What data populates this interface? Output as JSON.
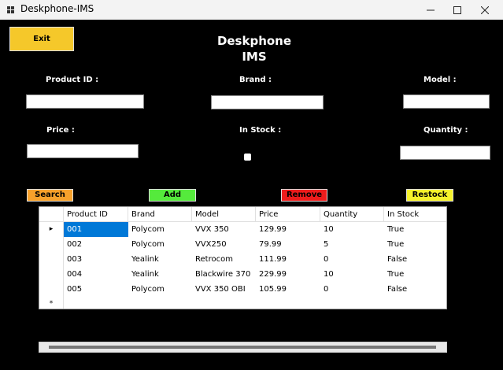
{
  "window": {
    "title": "Deskphone-IMS",
    "minimize_icon": "minimize-icon",
    "maximize_icon": "maximize-icon",
    "close_icon": "close-icon"
  },
  "header": {
    "title_line1": "Deskphone",
    "title_line2": "IMS"
  },
  "buttons": {
    "exit": {
      "label": "Exit",
      "color": "#f5c82a"
    },
    "search": {
      "label": "Search",
      "color": "#f7a12b"
    },
    "add": {
      "label": "Add",
      "color": "#55ea3c"
    },
    "remove": {
      "label": "Remove",
      "color": "#ee1c1c"
    },
    "restock": {
      "label": "Restock",
      "color": "#f5f22b"
    }
  },
  "form": {
    "product_id_label": "Product ID :",
    "brand_label": "Brand :",
    "model_label": "Model :",
    "price_label": "Price :",
    "in_stock_label": "In Stock :",
    "quantity_label": "Quantity :",
    "product_id_value": "",
    "brand_value": "",
    "model_value": "",
    "price_value": "",
    "quantity_value": "",
    "in_stock_checked": false
  },
  "table": {
    "columns": [
      "Product ID",
      "Brand",
      "Model",
      "Price",
      "Quantity",
      "In Stock"
    ],
    "rows": [
      [
        "001",
        "Polycom",
        "VVX 350",
        "129.99",
        "10",
        "True"
      ],
      [
        "002",
        "Polycom",
        "VVX250",
        "79.99",
        "5",
        "True"
      ],
      [
        "003",
        "Yealink",
        "Retrocom",
        "111.99",
        "0",
        "False"
      ],
      [
        "004",
        "Yealink",
        "Blackwire 370",
        "229.99",
        "10",
        "True"
      ],
      [
        "005",
        "Polycom",
        "VVX 350 OBI",
        "105.99",
        "0",
        "False"
      ]
    ],
    "current_row_marker": "▸",
    "new_row_marker": "*"
  }
}
